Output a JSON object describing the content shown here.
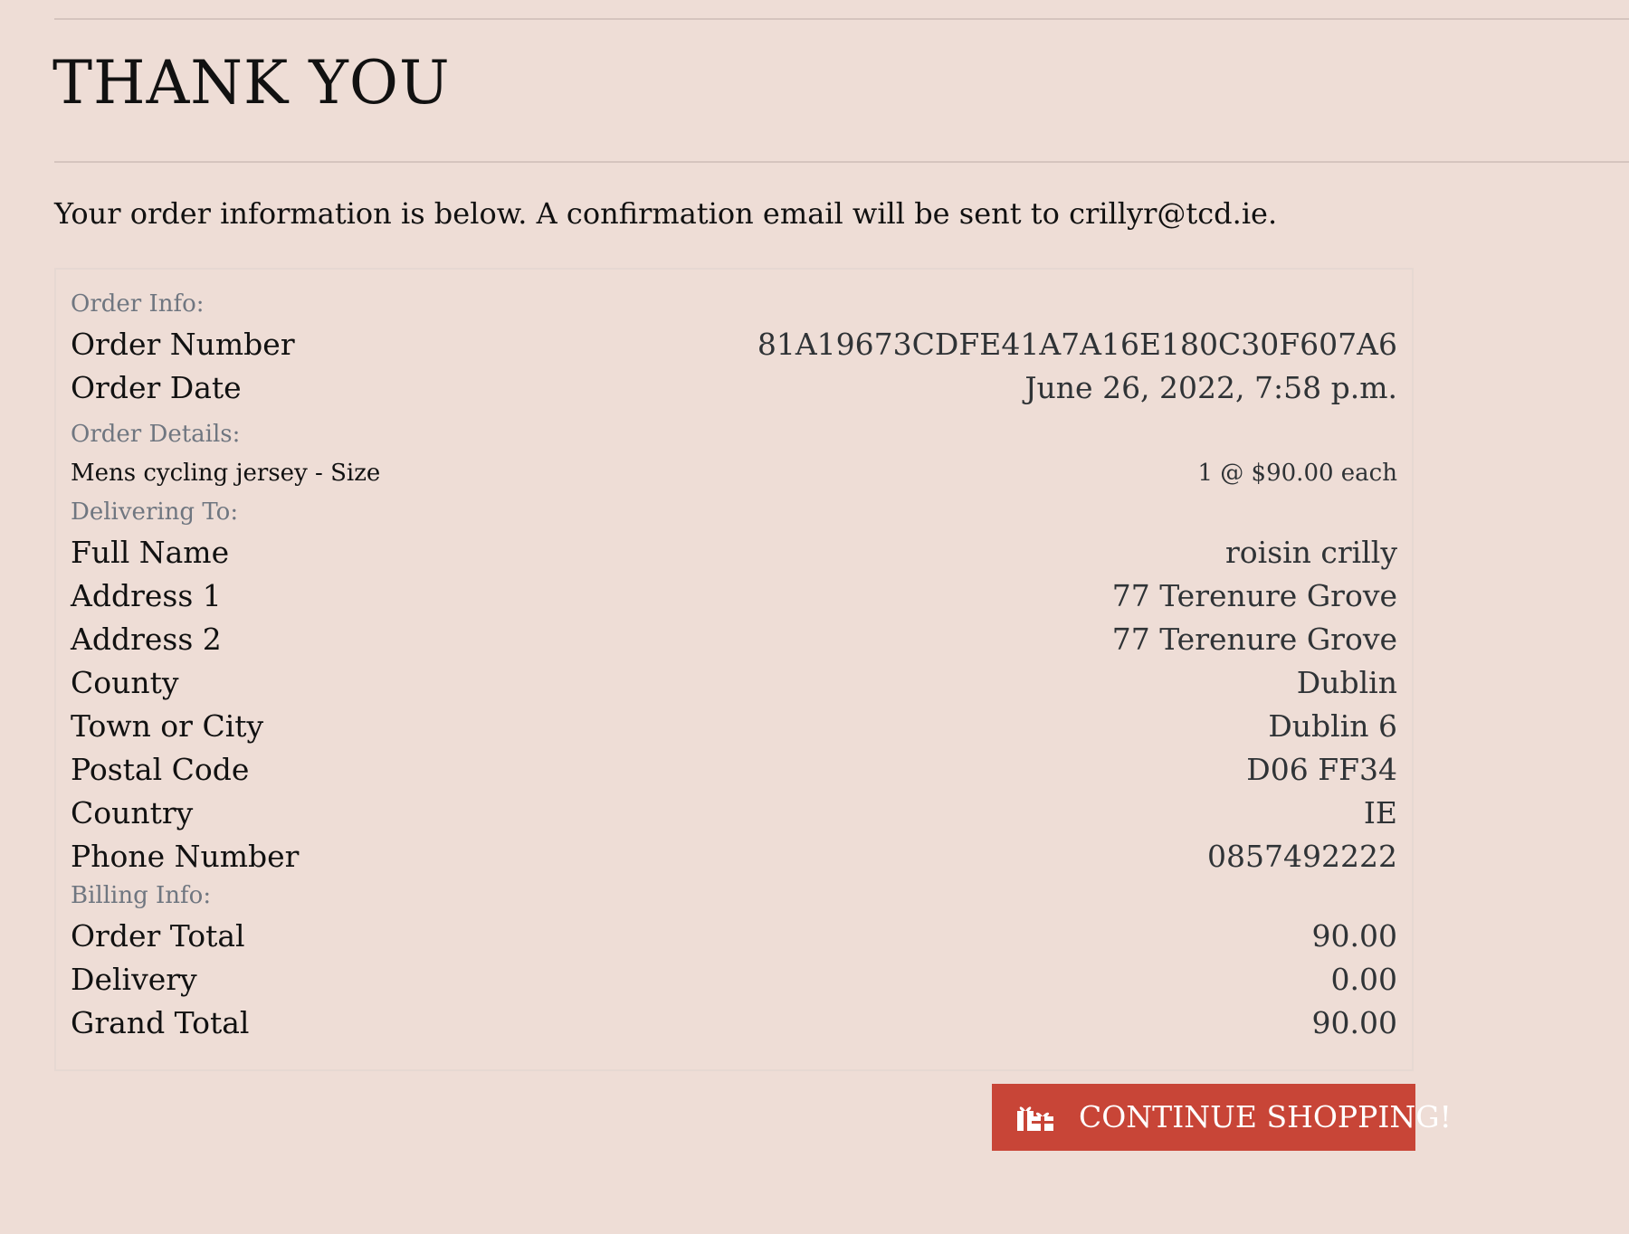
{
  "header": {
    "title": "THANK YOU"
  },
  "intro": {
    "text": "Your order information is below. A confirmation email will be sent to crillyr@tcd.ie."
  },
  "order_info": {
    "section_label": "Order Info:",
    "rows": [
      {
        "label": "Order Number",
        "value": "81A19673CDFE41A7A16E180C30F607A6"
      },
      {
        "label": "Order Date",
        "value": "June 26, 2022, 7:58 p.m."
      }
    ]
  },
  "order_details": {
    "section_label": "Order Details:",
    "items": [
      {
        "name": "Mens cycling jersey - Size",
        "quantity_price": "1 @ $90.00 each"
      }
    ]
  },
  "delivering_to": {
    "section_label": "Delivering To:",
    "rows": [
      {
        "label": "Full Name",
        "value": "roisin crilly"
      },
      {
        "label": "Address 1",
        "value": "77 Terenure Grove"
      },
      {
        "label": "Address 2",
        "value": "77 Terenure Grove"
      },
      {
        "label": "County",
        "value": "Dublin"
      },
      {
        "label": "Town or City",
        "value": "Dublin 6"
      },
      {
        "label": "Postal Code",
        "value": "D06 FF34"
      },
      {
        "label": "Country",
        "value": "IE"
      },
      {
        "label": "Phone Number",
        "value": "0857492222"
      }
    ]
  },
  "billing_info": {
    "section_label": "Billing Info:",
    "rows": [
      {
        "label": "Order Total",
        "value": "90.00"
      },
      {
        "label": "Delivery",
        "value": "0.00"
      },
      {
        "label": "Grand Total",
        "value": "90.00"
      }
    ]
  },
  "continue_button": {
    "label": "CONTINUE SHOPPING!",
    "icon": "gifts-icon",
    "color": "#c84537"
  },
  "colors": {
    "background": "#eeddd6",
    "section_label": "#6f7680",
    "value_text": "#2f3336"
  }
}
